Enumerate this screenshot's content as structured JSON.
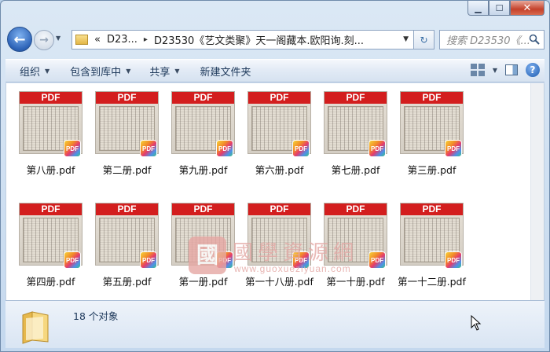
{
  "window": {
    "caption_min": "▁",
    "caption_max": "☐",
    "caption_close": "✕"
  },
  "nav": {
    "back_glyph": "←",
    "forward_glyph": "→",
    "dropdown_glyph": "▼",
    "address": {
      "overflow_glyph": "«",
      "crumbs": [
        "D23...",
        "D23530《艺文类聚》天一阁藏本.欧阳询.刻..."
      ],
      "sep_glyph": "▸",
      "drop_glyph": "▼"
    },
    "refresh_glyph": "↻",
    "search_placeholder": "搜索 D23530《..."
  },
  "toolbar": {
    "organize": "组织",
    "include_in_library": "包含到库中",
    "share": "共享",
    "new_folder": "新建文件夹",
    "arrow": "▼",
    "help": "?"
  },
  "files": [
    {
      "name": "第八册.pdf",
      "band": "PDF",
      "badge": "PDF"
    },
    {
      "name": "第二册.pdf",
      "band": "PDF",
      "badge": "PDF"
    },
    {
      "name": "第九册.pdf",
      "band": "PDF",
      "badge": "PDF"
    },
    {
      "name": "第六册.pdf",
      "band": "PDF",
      "badge": "PDF"
    },
    {
      "name": "第七册.pdf",
      "band": "PDF",
      "badge": "PDF"
    },
    {
      "name": "第三册.pdf",
      "band": "PDF",
      "badge": "PDF"
    },
    {
      "name": "第四册.pdf",
      "band": "PDF",
      "badge": "PDF"
    },
    {
      "name": "第五册.pdf",
      "band": "PDF",
      "badge": "PDF"
    },
    {
      "name": "第一册.pdf",
      "band": "PDF",
      "badge": "PDF"
    },
    {
      "name": "第一十八册.pdf",
      "band": "PDF",
      "badge": "PDF"
    },
    {
      "name": "第一十册.pdf",
      "band": "PDF",
      "badge": "PDF"
    },
    {
      "name": "第一十二册.pdf",
      "band": "PDF",
      "badge": "PDF"
    }
  ],
  "watermark": {
    "seal": "國",
    "title": "國學資源網",
    "url": "www.guoxueziyuan.com"
  },
  "details": {
    "count": "18 个对象"
  },
  "colors": {
    "pdf_band": "#d31e1e",
    "toolbar_text": "#1e395b",
    "window_frame": "#6f8bab"
  }
}
